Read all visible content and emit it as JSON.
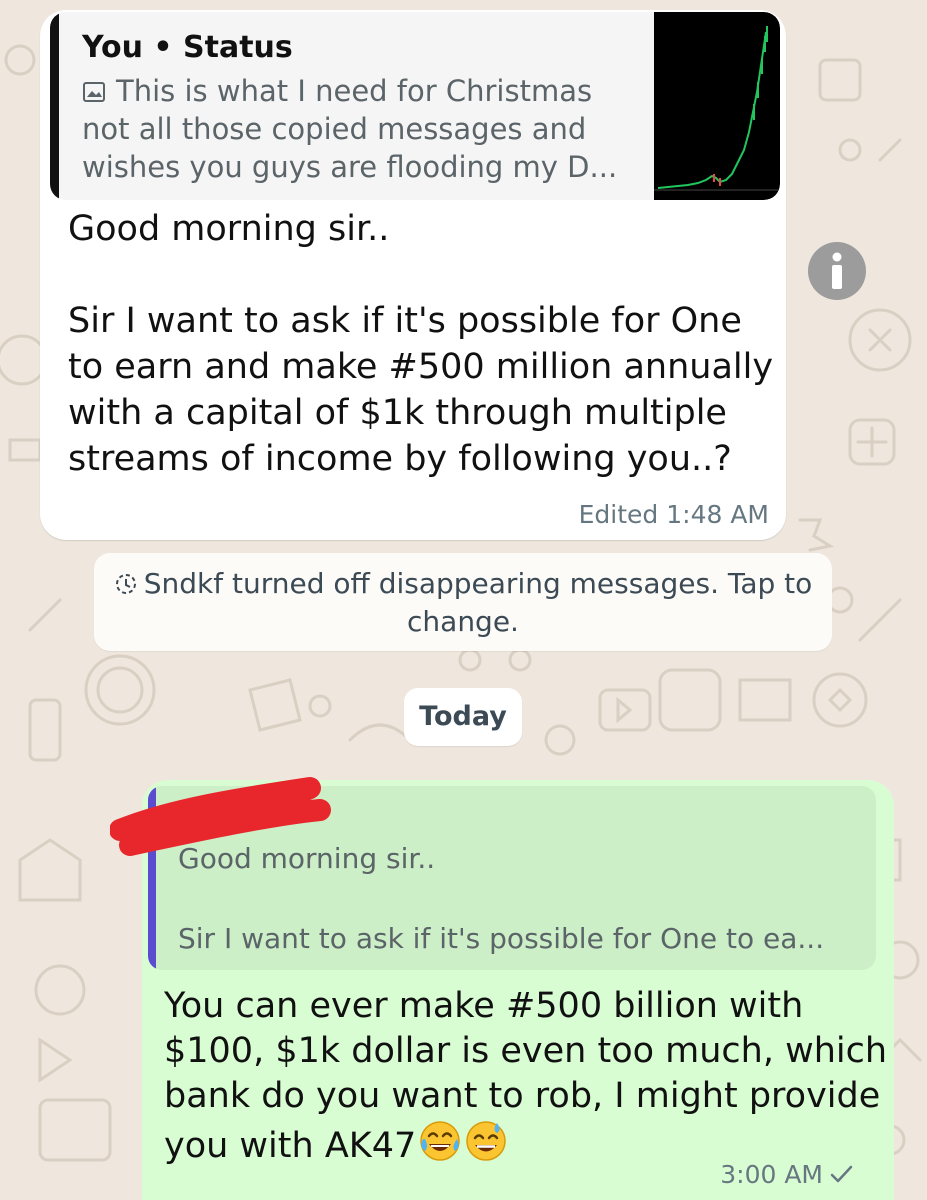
{
  "status_reply": {
    "title": "You • Status",
    "caption_line1": "This is what I need for Christmas",
    "caption_line2": "not all those copied messages and",
    "caption_line3": "wishes you guys are flooding my D..."
  },
  "incoming_message": {
    "line1": "Good morning sir..",
    "line2": "Sir I want to ask if it's possible for One",
    "line3": "to earn and make #500 million annually",
    "line4": "with a capital of $1k through multiple",
    "line5": "streams of income by  following you..?",
    "meta": "Edited  1:48 AM"
  },
  "system_message": {
    "line1": "Sndkf turned off disappearing messages. Tap to",
    "line2": "change."
  },
  "date_chip": "Today",
  "outgoing_message": {
    "quote_line1": "Good morning sir..",
    "quote_line2": "Sir I want to ask if it's possible for One to ea...",
    "line1": "You can ever make #500 billion with",
    "line2": "$100, $1k dollar is even too much, which",
    "line3": "bank do you want to rob, I might provide",
    "line4": "you with AK47",
    "time": "3:00 AM"
  },
  "colors": {
    "chat_background": "#efe7dd",
    "incoming_bubble": "#ffffff",
    "outgoing_bubble": "#d9fdd3",
    "quote_bar_reply": "#5b4ccf",
    "redaction": "#e8272d"
  },
  "icons": [
    "image-icon",
    "info-icon",
    "timer-icon",
    "check-icon",
    "tears-of-joy-emoji",
    "sweat-smile-emoji"
  ]
}
